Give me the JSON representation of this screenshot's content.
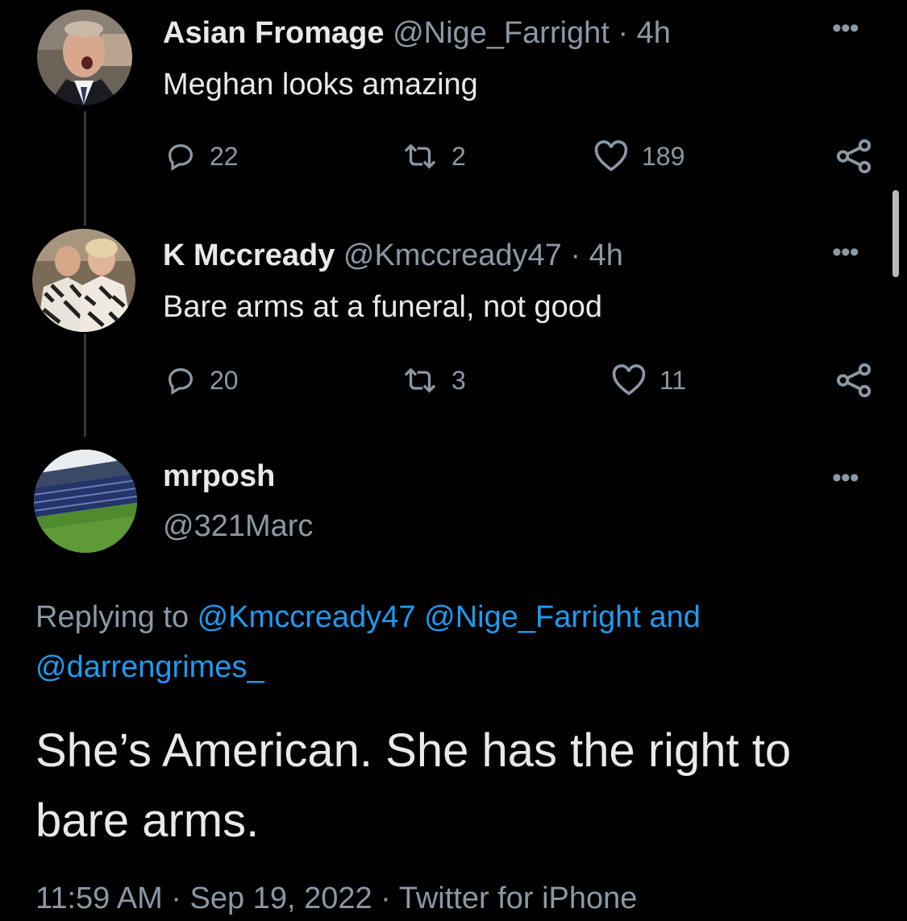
{
  "tweets": [
    {
      "name": "Asian Fromage",
      "handle": "@Nige_Farright",
      "sep": " · ",
      "time": "4h",
      "text": "Meghan looks amazing",
      "replies": "22",
      "retweets": "2",
      "likes": "189"
    },
    {
      "name": "K Mccready",
      "handle": "@Kmccready47",
      "sep": " · ",
      "time": "4h",
      "text": "Bare arms at a funeral, not good",
      "replies": "20",
      "retweets": "3",
      "likes": "11"
    }
  ],
  "main_tweet": {
    "name": "mrposh",
    "handle": "@321Marc",
    "replying_prefix": "Replying to ",
    "mention_1": "@Kmccready47",
    "mention_2": "@Nige_Farright",
    "replying_and": " and ",
    "mention_3": "@darrengrimes_",
    "text": "She’s American. She has the right to bare arms.",
    "time": "11:59 AM",
    "sep": " · ",
    "date": "Sep 19, 2022",
    "source": "Twitter for iPhone"
  },
  "icons": {
    "reply": "reply-icon",
    "retweet": "retweet-icon",
    "like": "heart-icon",
    "share": "share-icon",
    "more": "more-options-icon"
  },
  "colors": {
    "background": "#000000",
    "text": "#e7e9ea",
    "secondary": "#8b98a5",
    "link": "#1d9bf0"
  }
}
